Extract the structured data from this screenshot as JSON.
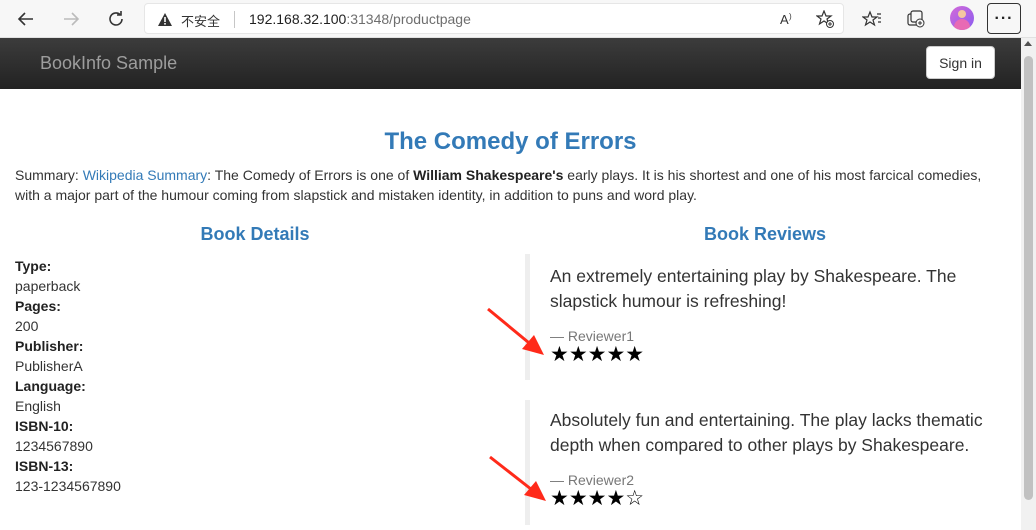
{
  "browser": {
    "security_label": "不安全",
    "url_host": "192.168.32.100",
    "url_rest": ":31348/productpage",
    "more_label": "···"
  },
  "navbar": {
    "brand": "BookInfo Sample",
    "signin_label": "Sign in"
  },
  "book": {
    "title": "The Comedy of Errors",
    "summary_prefix": "Summary: ",
    "summary_link": "Wikipedia Summary",
    "summary_mid": ": The Comedy of Errors is one of ",
    "summary_bold": "William Shakespeare's",
    "summary_rest": " early plays. It is his shortest and one of his most farcical comedies, with a major part of the humour coming from slapstick and mistaken identity, in addition to puns and word play."
  },
  "details": {
    "heading": "Book Details",
    "type_label": "Type:",
    "type_value": "paperback",
    "pages_label": "Pages:",
    "pages_value": "200",
    "publisher_label": "Publisher:",
    "publisher_value": "PublisherA",
    "language_label": "Language:",
    "language_value": "English",
    "isbn10_label": "ISBN-10:",
    "isbn10_value": "1234567890",
    "isbn13_label": "ISBN-13:",
    "isbn13_value": "123-1234567890"
  },
  "reviews": {
    "heading": "Book Reviews",
    "items": [
      {
        "text": "An extremely entertaining play by Shakespeare. The slapstick humour is refreshing!",
        "reviewer": "— Reviewer1",
        "stars": "★★★★★",
        "rating": 5
      },
      {
        "text": "Absolutely fun and entertaining. The play lacks thematic depth when compared to other plays by Shakespeare.",
        "reviewer": "— Reviewer2",
        "stars": "★★★★☆",
        "rating": 4
      }
    ]
  },
  "colors": {
    "link": "#337ab7",
    "navbar": "#222222",
    "annotation_arrow": "#ff2a1a"
  }
}
